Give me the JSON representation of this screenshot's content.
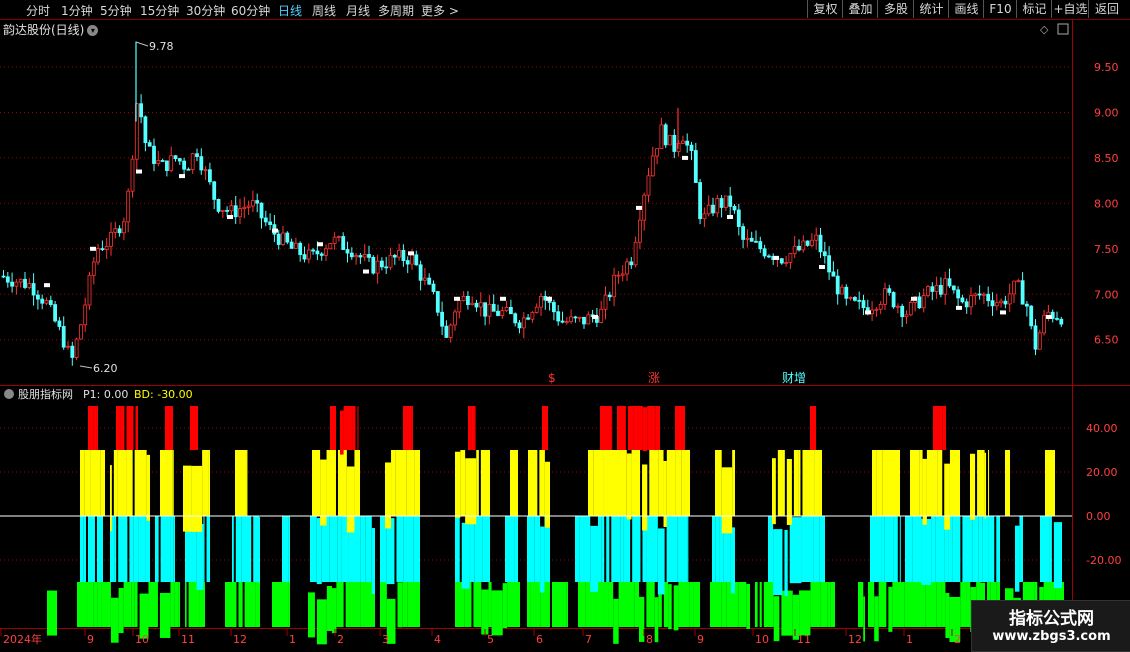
{
  "toolbar": {
    "timeframes": [
      {
        "label": "分时",
        "active": false
      },
      {
        "label": "1分钟",
        "active": false
      },
      {
        "label": "5分钟",
        "active": false
      },
      {
        "label": "15分钟",
        "active": false
      },
      {
        "label": "30分钟",
        "active": false
      },
      {
        "label": "60分钟",
        "active": false
      },
      {
        "label": "日线",
        "active": true
      },
      {
        "label": "周线",
        "active": false
      },
      {
        "label": "月线",
        "active": false
      },
      {
        "label": "多周期",
        "active": false
      },
      {
        "label": "更多 >",
        "active": false
      }
    ],
    "right_buttons": [
      "复权",
      "叠加",
      "多股",
      "统计",
      "画线",
      "F10",
      "标记",
      "+自选",
      "返回"
    ]
  },
  "main_chart": {
    "title": "韵达股份(日线)",
    "price_labels": [
      "9.50",
      "9.00",
      "8.50",
      "8.00",
      "7.50",
      "7.00",
      "6.50"
    ],
    "high_marker": "9.78",
    "low_marker": "6.20",
    "event_labels": [
      "$",
      "涨",
      "财增"
    ]
  },
  "indicator": {
    "name": "股朋指标网",
    "p1_text": "P1: 0.00",
    "bd_text": "BD: -30.00",
    "axis_labels": [
      "40.00",
      "20.00",
      "0.00",
      "-20.00"
    ]
  },
  "time_axis": [
    "2024年",
    "9",
    "10",
    "11",
    "12",
    "1",
    "2",
    "3",
    "4",
    "5",
    "6",
    "7",
    "8",
    "9",
    "10",
    "11",
    "12",
    "1",
    "2"
  ],
  "watermark": {
    "line1": "指标公式网",
    "line2": "www.zbgs3.com"
  },
  "colors": {
    "up": "#ff3232",
    "down": "#54ffff",
    "red_band": "#ff0000",
    "yellow_band": "#ffff00",
    "cyan_band": "#00ffff",
    "green_band": "#00ff00",
    "grid": "#a00000"
  }
}
